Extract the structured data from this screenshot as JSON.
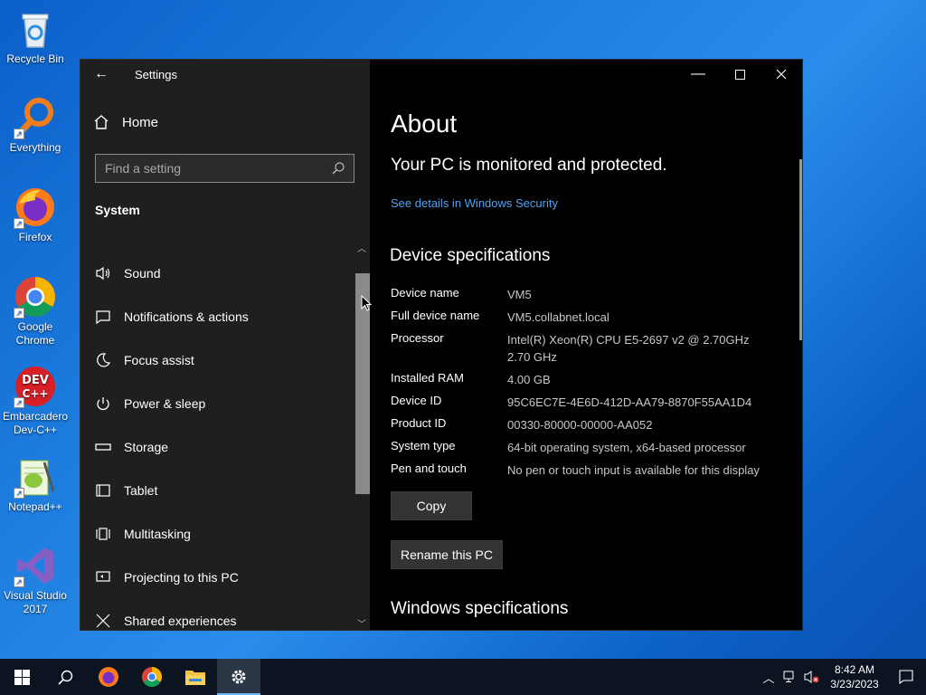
{
  "desktop": {
    "icons": [
      {
        "label": "Recycle Bin",
        "icon": "recycle-bin-icon"
      },
      {
        "label": "Everything",
        "icon": "everything-search-icon"
      },
      {
        "label": "Firefox",
        "icon": "firefox-icon"
      },
      {
        "label": "Google Chrome",
        "icon": "chrome-icon"
      },
      {
        "label": "Embarcadero Dev-C++",
        "icon": "devcpp-icon"
      },
      {
        "label": "Notepad++",
        "icon": "notepadpp-icon"
      },
      {
        "label": "Visual Studio 2017",
        "icon": "visual-studio-icon"
      }
    ]
  },
  "window": {
    "title": "Settings",
    "nav": {
      "home_label": "Home",
      "search_placeholder": "Find a setting",
      "section": "System",
      "items": [
        {
          "label": "Sound",
          "icon": "speaker-icon"
        },
        {
          "label": "Notifications & actions",
          "icon": "notification-icon"
        },
        {
          "label": "Focus assist",
          "icon": "moon-icon"
        },
        {
          "label": "Power & sleep",
          "icon": "power-icon"
        },
        {
          "label": "Storage",
          "icon": "storage-icon"
        },
        {
          "label": "Tablet",
          "icon": "tablet-icon"
        },
        {
          "label": "Multitasking",
          "icon": "multitasking-icon"
        },
        {
          "label": "Projecting to this PC",
          "icon": "projecting-icon"
        },
        {
          "label": "Shared experiences",
          "icon": "shared-icon"
        }
      ]
    },
    "content": {
      "title": "About",
      "protected_text": "Your PC is monitored and protected.",
      "security_link": "See details in Windows Security",
      "device_spec_title": "Device specifications",
      "specs": [
        {
          "key": "Device name",
          "value": "VM5"
        },
        {
          "key": "Full device name",
          "value": "VM5.collabnet.local"
        },
        {
          "key": "Processor",
          "value": "Intel(R) Xeon(R) CPU E5-2697 v2 @ 2.70GHz 2.70 GHz"
        },
        {
          "key": "Installed RAM",
          "value": "4.00 GB"
        },
        {
          "key": "Device ID",
          "value": "95C6EC7E-4E6D-412D-AA79-8870F55AA1D4"
        },
        {
          "key": "Product ID",
          "value": "00330-80000-00000-AA052"
        },
        {
          "key": "System type",
          "value": "64-bit operating system, x64-based processor"
        },
        {
          "key": "Pen and touch",
          "value": "No pen or touch input is available for this display"
        }
      ],
      "copy_button": "Copy",
      "rename_button": "Rename this PC",
      "windows_spec_title": "Windows specifications"
    }
  },
  "taskbar": {
    "time": "8:42 AM",
    "date": "3/23/2023"
  }
}
